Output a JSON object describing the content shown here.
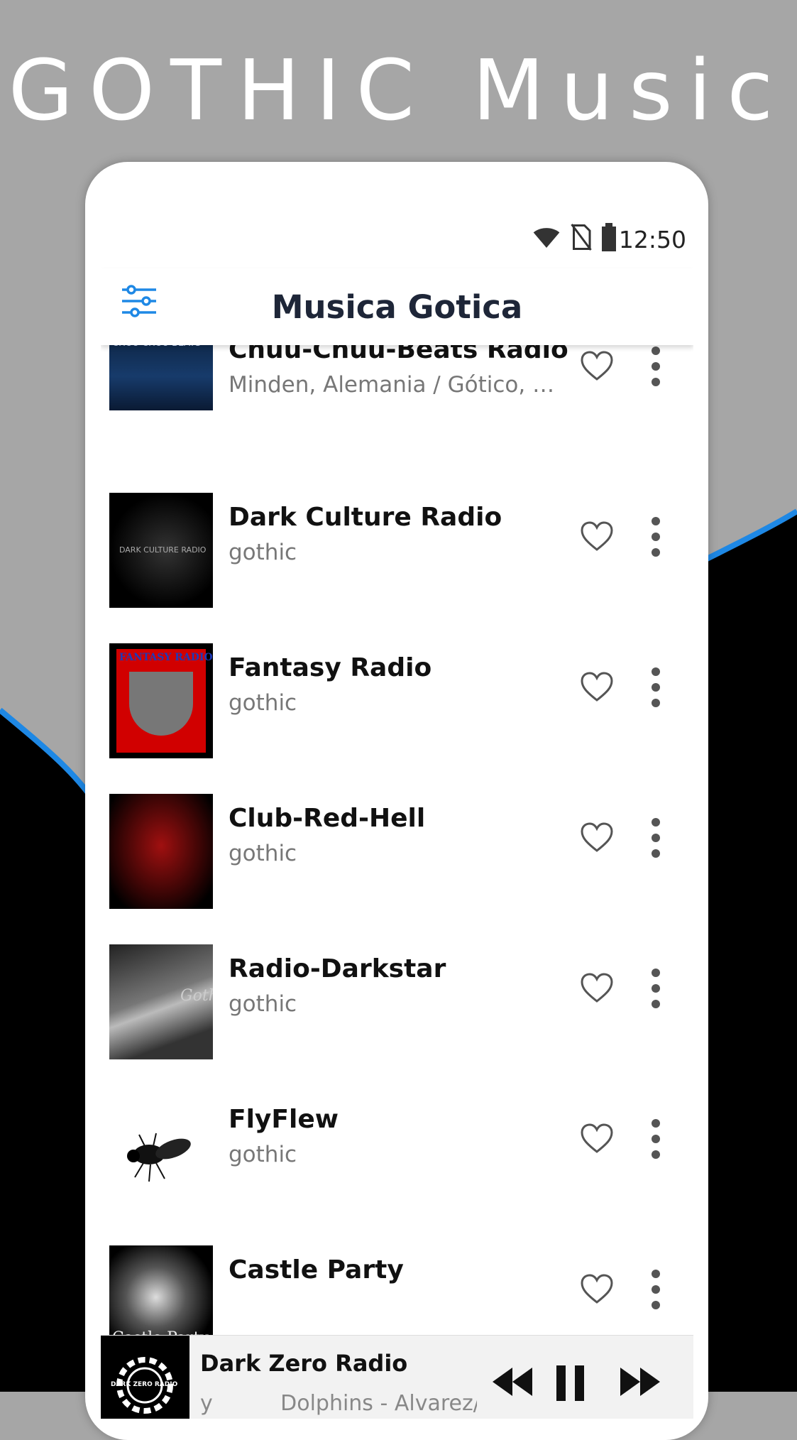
{
  "promo": {
    "title": "GOTHIC Music"
  },
  "status_bar": {
    "time": "12:50",
    "icons": [
      "wifi-icon",
      "no-sim-icon",
      "battery-icon"
    ]
  },
  "app_bar": {
    "title": "Musica Gotica",
    "filter_icon": "sliders-icon"
  },
  "stations": [
    {
      "name": "Chuu-Chuu-Beats Radio",
      "desc": "Minden, Alemania / Gótico, Pop,...",
      "thumb_text": "CHUU CHUU BEATS"
    },
    {
      "name": "Dark Culture Radio",
      "desc": "gothic",
      "thumb_text": "DARK CULTURE RADIO"
    },
    {
      "name": "Fantasy Radio",
      "desc": "gothic",
      "thumb_text": "FANTASY RADIO"
    },
    {
      "name": "Club-Red-Hell",
      "desc": "gothic",
      "thumb_text": ""
    },
    {
      "name": "Radio-Darkstar",
      "desc": "gothic",
      "thumb_text": "Goth"
    },
    {
      "name": "FlyFlew",
      "desc": "gothic",
      "thumb_text": ""
    },
    {
      "name": "Castle Party",
      "desc": "",
      "thumb_text": "Castle Party"
    }
  ],
  "player": {
    "title": "Dark Zero Radio",
    "subtitle": "y          Dolphins - Alvarez/",
    "logo_text": "DARK ZERO RADIO",
    "controls": [
      "rewind-icon",
      "pause-icon",
      "fast-forward-icon"
    ]
  },
  "colors": {
    "accent_blue": "#1e88e5",
    "title_dark": "#1e2638",
    "bg_gray": "#a6a6a6",
    "bg_black": "#000000"
  }
}
